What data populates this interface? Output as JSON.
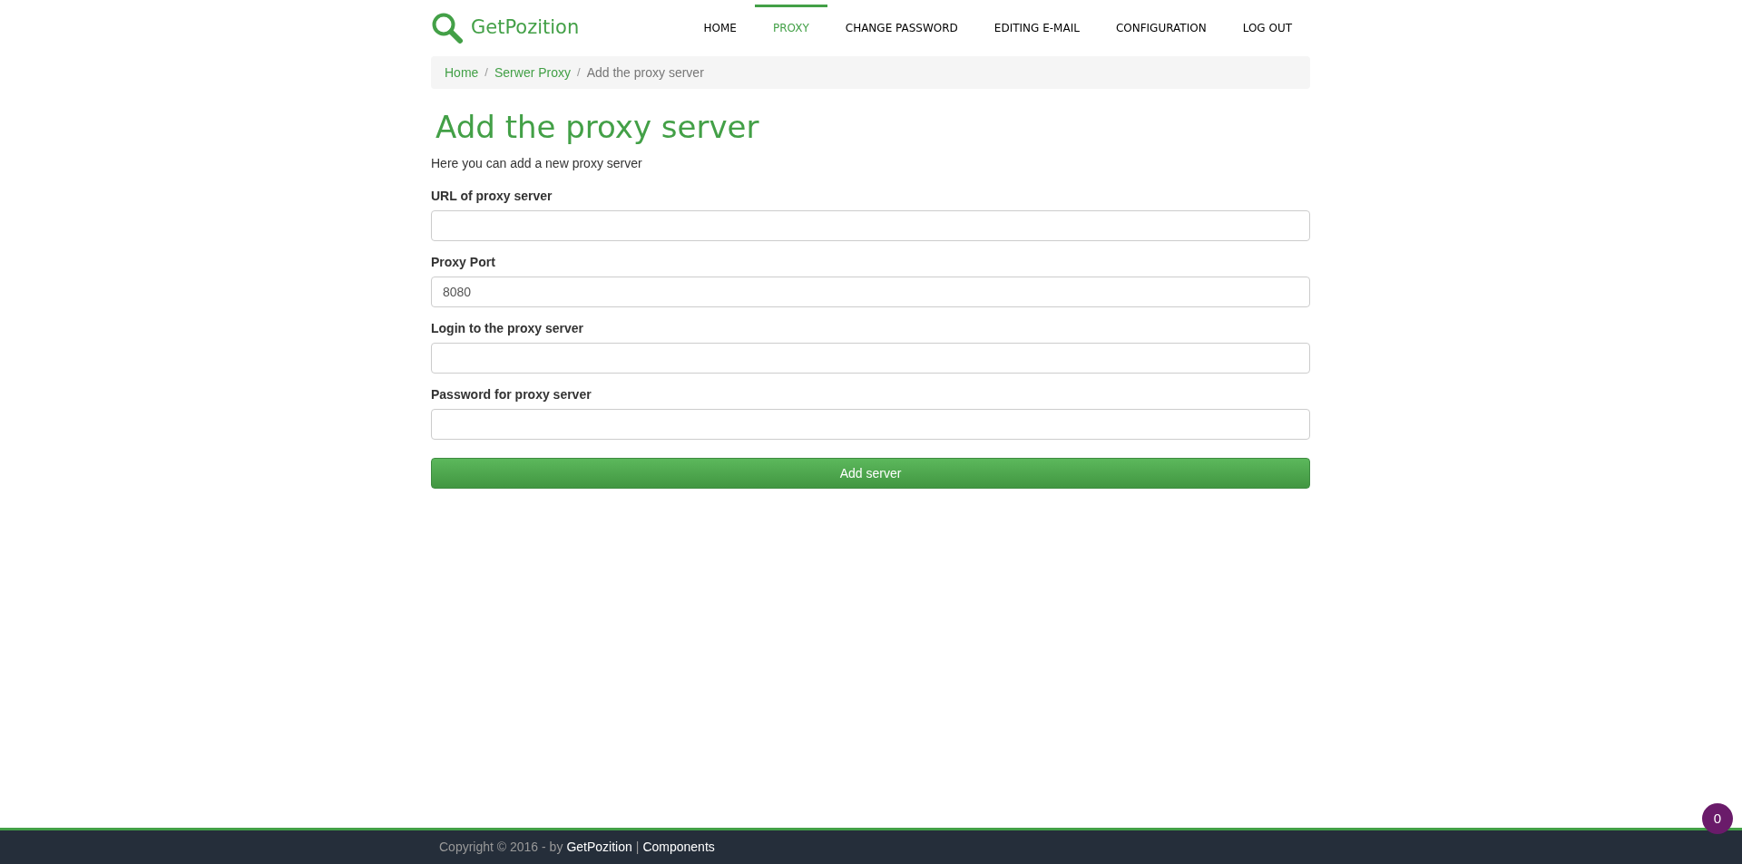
{
  "brand": {
    "name": "GetPozition"
  },
  "nav": [
    {
      "label": "HOME",
      "selected": false
    },
    {
      "label": "PROXY",
      "selected": true
    },
    {
      "label": "CHANGE PASSWORD",
      "selected": false
    },
    {
      "label": "EDITING E-MAIL",
      "selected": false
    },
    {
      "label": "CONFIGURATION",
      "selected": false
    },
    {
      "label": "LOG OUT",
      "selected": false
    }
  ],
  "breadcrumb": [
    {
      "label": "Home",
      "kind": "link"
    },
    {
      "label": "/",
      "kind": "divider"
    },
    {
      "label": "Serwer Proxy",
      "kind": "link"
    },
    {
      "label": "/",
      "kind": "divider"
    },
    {
      "label": "Add the proxy server",
      "kind": "current"
    }
  ],
  "heading": "Add the proxy server",
  "intro": "Here you can add a new proxy server",
  "fields": [
    {
      "label": "URL of proxy server"
    },
    {
      "label": "Proxy Port",
      "value": "8080"
    },
    {
      "label": "Login to the proxy server"
    },
    {
      "label": "Password for proxy server"
    }
  ],
  "submit": "Add server",
  "footer": {
    "text": "Copyright © 2016 - by",
    "link_1": "GetPozition",
    "separator": "|",
    "link_2": "Components"
  },
  "badge": "0"
}
